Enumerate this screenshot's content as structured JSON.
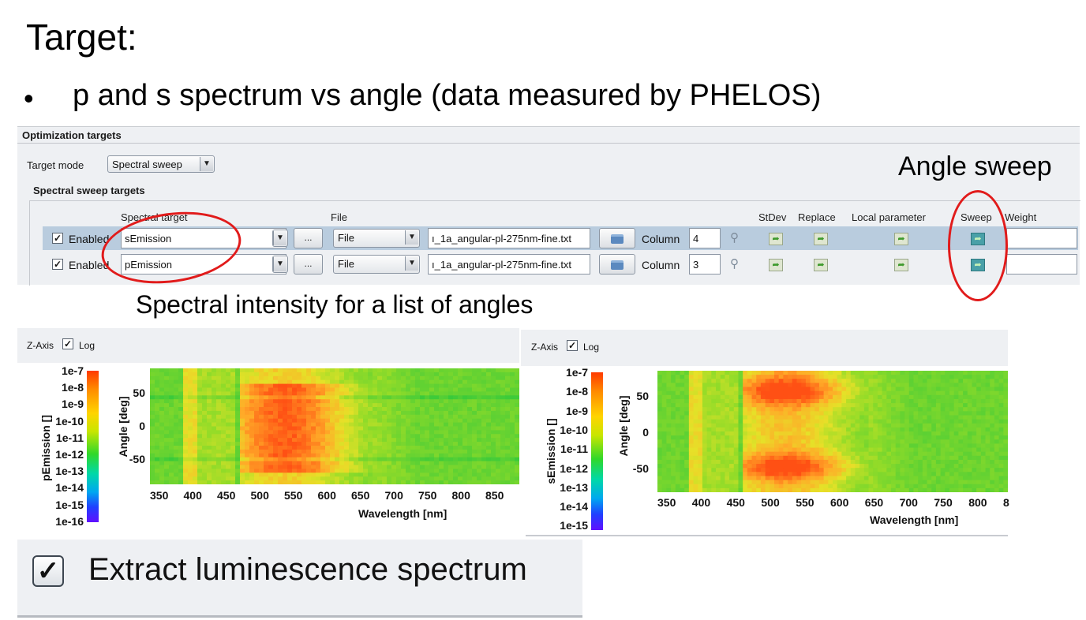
{
  "slide": {
    "title": "Target:",
    "bullet_marker": "•",
    "bullet": "p and s spectrum vs angle (data measured by PHELOS)",
    "annotation_angle_sweep": "Angle sweep",
    "annotation_spectral": "Spectral intensity for a list of angles",
    "annotation_color": "#e11b1b"
  },
  "panel": {
    "title": "Optimization targets",
    "target_mode_label": "Target mode",
    "target_mode_value": "Spectral sweep",
    "sweep_targets_title": "Spectral sweep targets",
    "headers": {
      "spectral_target": "Spectral target",
      "file": "File",
      "stdev": "StDev",
      "replace": "Replace",
      "local_parameter": "Local parameter",
      "sweep": "Sweep",
      "weight": "Weight"
    },
    "rows": [
      {
        "enabled_label": "Enabled",
        "checked_mark": "✓",
        "spectral_target": "sEmission",
        "browse": "...",
        "source": "File",
        "file_name": "ı_1a_angular-pl-275nm-fine.txt",
        "column_label": "Column",
        "column": "4",
        "weight": ""
      },
      {
        "enabled_label": "Enabled",
        "checked_mark": "✓",
        "spectral_target": "pEmission",
        "browse": "...",
        "source": "File",
        "file_name": "ı_1a_angular-pl-275nm-fine.txt",
        "column_label": "Column",
        "column": "3",
        "weight": ""
      }
    ]
  },
  "plots": [
    {
      "zaxis_label": "Z-Axis",
      "log_label": "Log",
      "log_checked_mark": "✓",
      "colorbar_label": "pEmission []",
      "colorbar_ticks": [
        "1e-7",
        "1e-8",
        "1e-9",
        "1e-10",
        "1e-11",
        "1e-12",
        "1e-13",
        "1e-14",
        "1e-15",
        "1e-16"
      ],
      "ylabel": "Angle [deg]",
      "yticks": [
        "50",
        "0",
        "-50"
      ],
      "xlabel": "Wavelength [nm]",
      "xticks": [
        "350",
        "400",
        "450",
        "500",
        "550",
        "600",
        "650",
        "700",
        "750",
        "800",
        "850"
      ]
    },
    {
      "zaxis_label": "Z-Axis",
      "log_label": "Log",
      "log_checked_mark": "✓",
      "colorbar_label": "sEmission []",
      "colorbar_ticks": [
        "1e-7",
        "1e-8",
        "1e-9",
        "1e-10",
        "1e-11",
        "1e-12",
        "1e-13",
        "1e-14",
        "1e-15"
      ],
      "ylabel": "Angle [deg]",
      "yticks": [
        "50",
        "0",
        "-50"
      ],
      "xlabel": "Wavelength [nm]",
      "xticks": [
        "350",
        "400",
        "450",
        "500",
        "550",
        "600",
        "650",
        "700",
        "750",
        "800",
        "8"
      ]
    }
  ],
  "extract": {
    "label": "Extract luminescence spectrum",
    "checked_mark": "✓"
  },
  "chart_data": [
    {
      "type": "heatmap",
      "x_axis": "Wavelength [nm]",
      "y_axis": "Angle [deg]",
      "z_axis": "pEmission []",
      "z_scale": "log",
      "z_range": [
        1e-16,
        1e-07
      ],
      "y_range": [
        -90,
        90
      ],
      "peak_region_nm": [
        495,
        640
      ],
      "peak_region_deg": [
        -80,
        80
      ]
    },
    {
      "type": "heatmap",
      "x_axis": "Wavelength [nm]",
      "y_axis": "Angle [deg]",
      "z_axis": "sEmission []",
      "z_scale": "log",
      "z_range": [
        1e-15,
        1e-07
      ],
      "y_range": [
        -90,
        90
      ],
      "peak_region_nm": [
        500,
        640
      ],
      "peak_angles_deg": [
        70,
        -55
      ]
    }
  ]
}
